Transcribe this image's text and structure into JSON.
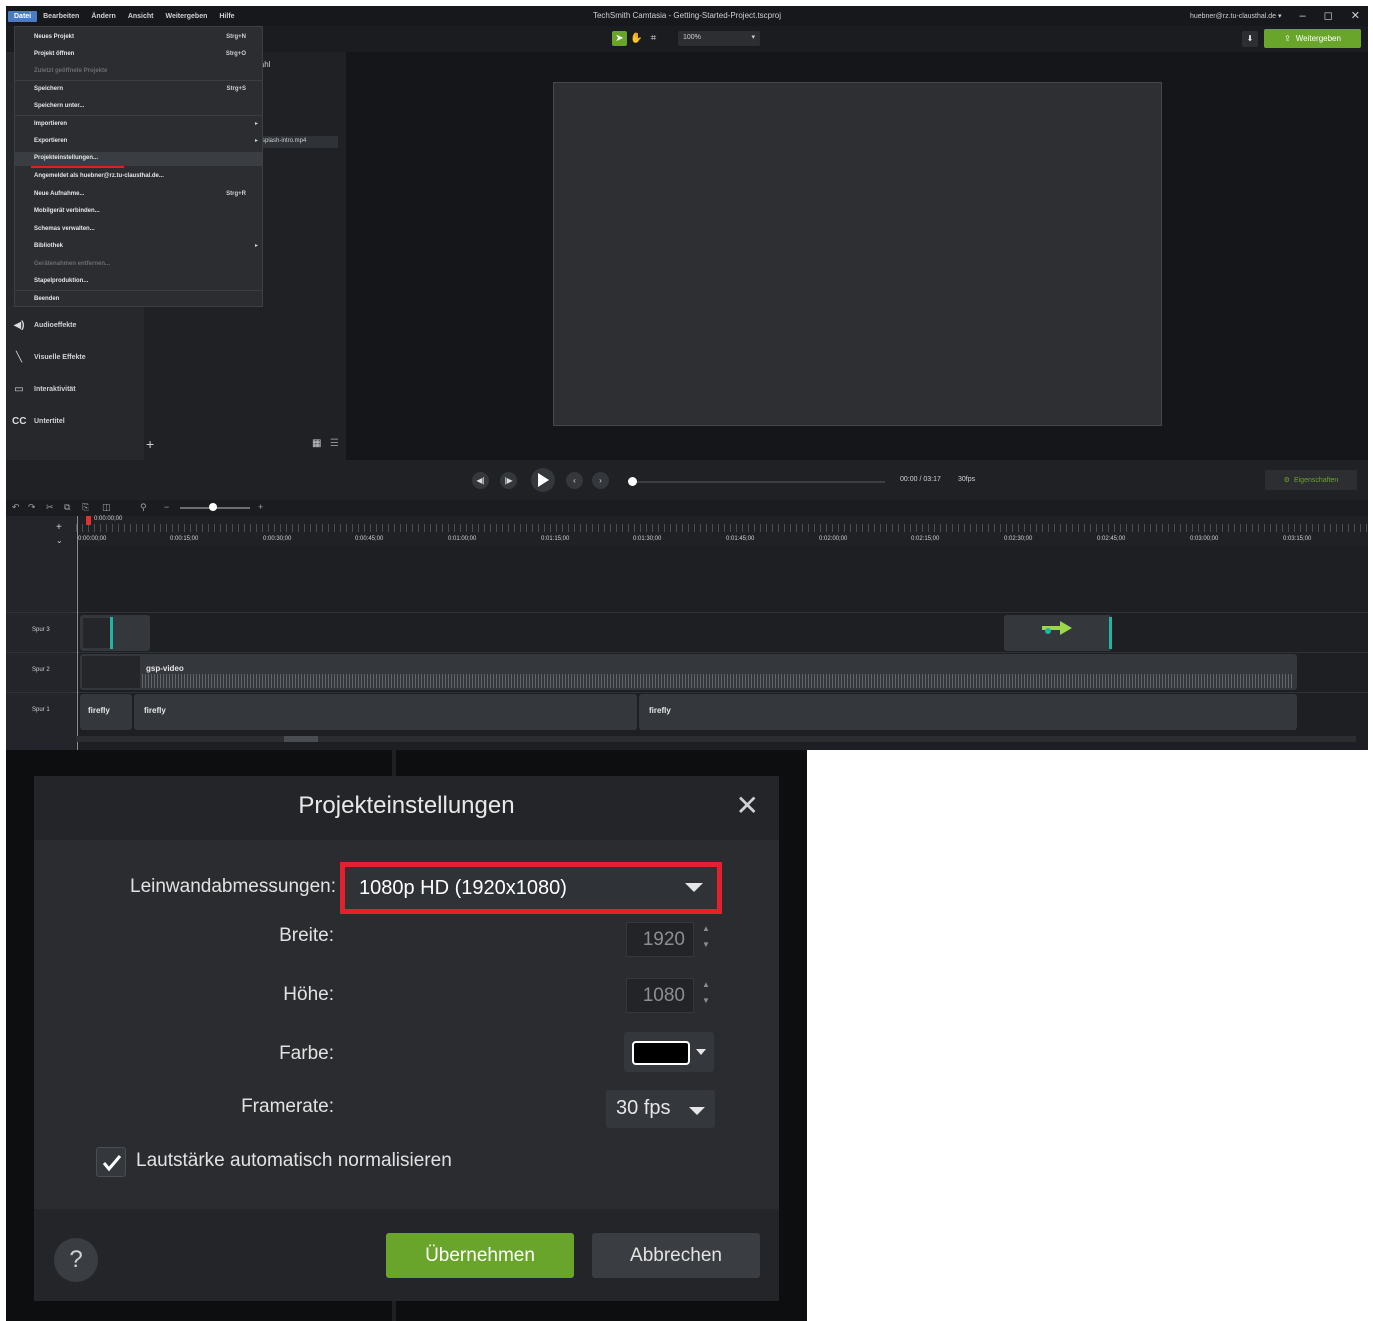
{
  "app": {
    "title": "TechSmith Camtasia - Getting-Started-Project.tscproj",
    "user": "huebner@rz.tu-clausthal.de ▾",
    "menu": [
      "Datei",
      "Bearbeiten",
      "Ändern",
      "Ansicht",
      "Weitergeben",
      "Hilfe"
    ],
    "zoom": "100%",
    "share_label": "Weitergeben"
  },
  "file_menu": {
    "items": [
      {
        "label": "Neues Projekt",
        "shortcut": "Strg+N"
      },
      {
        "label": "Projekt öffnen",
        "shortcut": "Strg+O"
      },
      {
        "label": "Zuletzt geöffnete Projekte",
        "disabled": true
      },
      {
        "label": "Speichern",
        "shortcut": "Strg+S"
      },
      {
        "label": "Speichern unter..."
      },
      {
        "label": "Importieren",
        "submenu": true
      },
      {
        "label": "Exportieren",
        "submenu": true
      },
      {
        "label": "Projekteinstellungen...",
        "highlighted": true
      },
      {
        "label": "Angemeldet als huebner@rz.tu-clausthal.de..."
      },
      {
        "label": "Neue Aufnahme...",
        "shortcut": "Strg+R"
      },
      {
        "label": "Mobilgerät verbinden..."
      },
      {
        "label": "Schemas verwalten..."
      },
      {
        "label": "Bibliothek",
        "submenu": true
      },
      {
        "label": "Gerätenahmen entfernen...",
        "disabled": true
      },
      {
        "label": "Stapelproduktion..."
      },
      {
        "label": "Beenden"
      }
    ]
  },
  "media_bin": {
    "header": "wahl",
    "item": "splash-intro.mp4"
  },
  "side_tools": [
    {
      "icon": "speaker-icon",
      "glyph": "◀)",
      "label": "Audioeffekte"
    },
    {
      "icon": "magic-wand-icon",
      "glyph": "╲",
      "label": "Visuelle Effekte"
    },
    {
      "icon": "interactivity-icon",
      "glyph": "▭",
      "label": "Interaktivität"
    },
    {
      "icon": "cc-icon",
      "glyph": "CC",
      "label": "Untertitel"
    }
  ],
  "playback": {
    "time": "00:00 / 03:17",
    "fps": "30fps",
    "properties_label": "Eigenschaften"
  },
  "timeline": {
    "playhead": "0:00:00;00",
    "ruler": [
      "0:00:00;00",
      "0:00:15;00",
      "0:00:30;00",
      "0:00:45;00",
      "0:01:00;00",
      "0:01:15;00",
      "0:01:30;00",
      "0:01:45;00",
      "0:02:00;00",
      "0:02:15;00",
      "0:02:30;00",
      "0:02:45;00",
      "0:03:00;00",
      "0:03:15;00"
    ],
    "tracks": [
      "Spur 3",
      "Spur 2",
      "Spur 1"
    ],
    "clips": {
      "video": "gsp-video",
      "firefly": "firefly"
    }
  },
  "dialog": {
    "title": "Projekteinstellungen",
    "canvas_label": "Leinwandabmessungen:",
    "canvas_value": "1080p HD (1920x1080)",
    "width_label": "Breite:",
    "width_value": "1920",
    "height_label": "Höhe:",
    "height_value": "1080",
    "color_label": "Farbe:",
    "color_value": "#000000",
    "framerate_label": "Framerate:",
    "framerate_value": "30 fps",
    "normalize_label": "Lautstärke automatisch normalisieren",
    "normalize_checked": true,
    "ok_label": "Übernehmen",
    "cancel_label": "Abbrechen",
    "help_label": "?"
  },
  "colors": {
    "accent_green": "#6aa52b",
    "highlight_red": "#e3202b"
  }
}
